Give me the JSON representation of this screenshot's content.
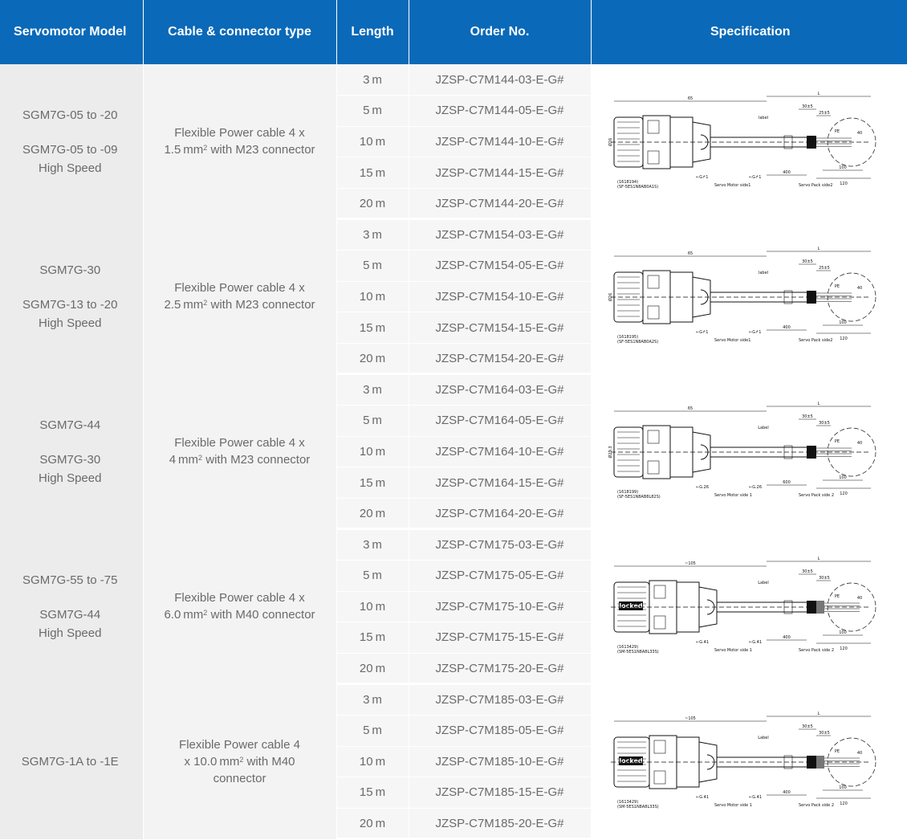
{
  "headers": {
    "model": "Servomotor Model",
    "cable": "Cable & connector type",
    "length": "Length",
    "order": "Order No.",
    "spec": "Specification"
  },
  "groups": [
    {
      "models": [
        "SGM7G-05 to -20",
        "SGM7G-05 to -09",
        "High Speed"
      ],
      "cable": {
        "line1": "Flexible Power cable 4 x",
        "line2_pre": "1.5 mm",
        "sup": "2",
        "line2_post": " with M23 connector"
      },
      "rows": [
        {
          "length": "3 m",
          "order": "JZSP-C7M144-03-E-G#"
        },
        {
          "length": "5 m",
          "order": "JZSP-C7M144-05-E-G#"
        },
        {
          "length": "10 m",
          "order": "JZSP-C7M144-10-E-G#"
        },
        {
          "length": "15 m",
          "order": "JZSP-C7M144-15-E-G#"
        },
        {
          "length": "20 m",
          "order": "JZSP-C7M144-20-E-G#"
        }
      ],
      "drawing": {
        "part": "(1618194)",
        "part2": "(SF-5ES1N8AB0A1S)",
        "dim_total": "65",
        "dim_l": "L",
        "dim_a": "30±5",
        "dim_b": "25±5",
        "dim_400": "400",
        "dim_100": "100",
        "dim_120": "120",
        "dim_40": "40",
        "dia": "Ø26",
        "motor": "Servo Motor side1",
        "pack": "Servo Pack side2",
        "label": "label",
        "g": "←G↱1",
        "pe": "PE"
      }
    },
    {
      "models": [
        "SGM7G-30",
        "SGM7G-13 to -20",
        "High Speed"
      ],
      "cable": {
        "line1": "Flexible Power cable 4 x",
        "line2_pre": "2.5 mm",
        "sup": "2",
        "line2_post": " with M23 connector"
      },
      "rows": [
        {
          "length": "3 m",
          "order": "JZSP-C7M154-03-E-G#"
        },
        {
          "length": "5 m",
          "order": "JZSP-C7M154-05-E-G#"
        },
        {
          "length": "10 m",
          "order": "JZSP-C7M154-10-E-G#"
        },
        {
          "length": "15 m",
          "order": "JZSP-C7M154-15-E-G#"
        },
        {
          "length": "20 m",
          "order": "JZSP-C7M154-20-E-G#"
        }
      ],
      "drawing": {
        "part": "(1618195)",
        "part2": "(SF-5ES1N8AB0A2S)",
        "dim_total": "65",
        "dim_l": "L",
        "dim_a": "30±5",
        "dim_b": "25±5",
        "dim_400": "400",
        "dim_100": "100",
        "dim_120": "120",
        "dim_40": "40",
        "dia": "Ø26",
        "motor": "Servo Motor side1",
        "pack": "Servo Pack side2",
        "label": "label",
        "g": "←G↱1",
        "pe": "PE"
      }
    },
    {
      "models": [
        "SGM7G-44",
        "SGM7G-30",
        "High Speed"
      ],
      "cable": {
        "line1": "Flexible Power cable 4 x",
        "line2_pre": "4 mm",
        "sup": "2",
        "line2_post": " with M23 connector"
      },
      "rows": [
        {
          "length": "3 m",
          "order": "JZSP-C7M164-03-E-G#"
        },
        {
          "length": "5 m",
          "order": "JZSP-C7M164-05-E-G#"
        },
        {
          "length": "10 m",
          "order": "JZSP-C7M164-10-E-G#"
        },
        {
          "length": "15 m",
          "order": "JZSP-C7M164-15-E-G#"
        },
        {
          "length": "20 m",
          "order": "JZSP-C7M164-20-E-G#"
        }
      ],
      "drawing": {
        "part": "(1618199)",
        "part2": "(SF-5ES1N8AB8L82S)",
        "dim_total": "65",
        "dim_l": "L",
        "dim_a": "30±5",
        "dim_b": "30±5",
        "dim_400": "600",
        "dim_100": "100",
        "dim_120": "120",
        "dim_40": "40",
        "dia": "Ø29.3",
        "motor": "Servo Motor side 1",
        "pack": "Servo Pack side 2",
        "label": "Label",
        "g": "←G.26",
        "pe": "PE"
      }
    },
    {
      "models": [
        "SGM7G-55 to -75",
        "SGM7G-44",
        "High Speed"
      ],
      "cable": {
        "line1": "Flexible Power cable 4 x",
        "line2_pre": "6.0 mm",
        "sup": "2",
        "line2_post": " with M40 connector"
      },
      "rows": [
        {
          "length": "3 m",
          "order": "JZSP-C7M175-03-E-G#"
        },
        {
          "length": "5 m",
          "order": "JZSP-C7M175-05-E-G#"
        },
        {
          "length": "10 m",
          "order": "JZSP-C7M175-10-E-G#"
        },
        {
          "length": "15 m",
          "order": "JZSP-C7M175-15-E-G#"
        },
        {
          "length": "20 m",
          "order": "JZSP-C7M175-20-E-G#"
        }
      ],
      "drawing": {
        "part": "(1613429)",
        "part2": "(SM-5ES1N8A8L33S)",
        "dim_total": "~105",
        "dim_l": "L",
        "dim_a": "30±5",
        "dim_b": "30±5",
        "dim_400": "400",
        "dim_100": "100",
        "dim_120": "120",
        "dim_40": "40",
        "dia": "",
        "motor": "Servo Motor side 1",
        "pack": "Servo Pack side 2",
        "label": "Label",
        "g": "←G.41",
        "pe": "PE",
        "locked": "locked"
      }
    },
    {
      "models": [
        "SGM7G-1A to -1E"
      ],
      "cable": {
        "line1": "Flexible Power cable 4",
        "line2_pre": "x 10.0 mm",
        "sup": "2",
        "line2_post": " with M40",
        "line3": "connector"
      },
      "rows": [
        {
          "length": "3 m",
          "order": "JZSP-C7M185-03-E-G#"
        },
        {
          "length": "5 m",
          "order": "JZSP-C7M185-05-E-G#"
        },
        {
          "length": "10 m",
          "order": "JZSP-C7M185-10-E-G#"
        },
        {
          "length": "15 m",
          "order": "JZSP-C7M185-15-E-G#"
        },
        {
          "length": "20 m",
          "order": "JZSP-C7M185-20-E-G#"
        }
      ],
      "drawing": {
        "part": "(1613429)",
        "part2": "(SM-5ES1N8A8L33S)",
        "dim_total": "~105",
        "dim_l": "L",
        "dim_a": "30±5",
        "dim_b": "30±5",
        "dim_400": "400",
        "dim_100": "100",
        "dim_120": "120",
        "dim_40": "40",
        "dia": "",
        "motor": "Servo Motor side 1",
        "pack": "Servo Pack side 2",
        "label": "Label",
        "g": "←G.41",
        "pe": "PE",
        "locked": "locked"
      }
    }
  ],
  "colors": {
    "header_bg": "#0a69b8",
    "header_text": "#ffffff",
    "cell_text": "#6a6a6a",
    "model_bg": "#ececec",
    "row_bg": "#f6f6f6"
  }
}
